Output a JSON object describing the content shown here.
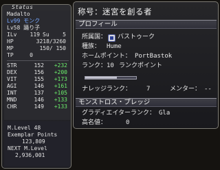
{
  "status": {
    "title": "Status",
    "name": "Madalto",
    "job_main": "Lv99 モンク",
    "job_sub": "Lv58 踊り子",
    "ilv_label": "ILv",
    "ilv_value": "119",
    "su_label": "Su",
    "su_value": "5",
    "hp_label": "HP",
    "hp_value": "3218/3260",
    "mp_label": "MP",
    "mp_value": "150/ 150",
    "tp_label": "TP",
    "tp_value": "0",
    "stats": [
      {
        "label": "STR",
        "base": "152",
        "bonus": "+232"
      },
      {
        "label": "DEX",
        "base": "156",
        "bonus": "+200"
      },
      {
        "label": "VIT",
        "base": "155",
        "bonus": "+173"
      },
      {
        "label": "AGI",
        "base": "146",
        "bonus": "+161"
      },
      {
        "label": "INT",
        "base": "137",
        "bonus": "+105"
      },
      {
        "label": "MND",
        "base": "146",
        "bonus": "+133"
      },
      {
        "label": "CHR",
        "base": "149",
        "bonus": "+133"
      }
    ],
    "master_level": "M.Level 48",
    "exemplar_label": "Exemplar Points",
    "exemplar_value": "123,809",
    "next_label": "NEXT M.Level",
    "next_value": "2,936,001"
  },
  "profile": {
    "title": "称号：迷宮を創る者",
    "section_profile": "プロフィール",
    "nation_label": "所属国：",
    "nation_value": "バストゥーク",
    "race_label": "種族：",
    "race_value": "Hume",
    "home_label": "ホームポイント：",
    "home_value": "PortBastok",
    "rank_label": "ランク：",
    "rank_value": "10",
    "rank_points_label": "ランクポイント",
    "rank_fill": 0.62,
    "knowledge_label": "ナレッジランク：",
    "knowledge_value": "7",
    "mentor_label": "メンター：",
    "mentor_value": "--",
    "section_pledge": "モンストロス・プレッジ",
    "gladiator_label": "グラディエイターランク：",
    "gladiator_value": "Gla",
    "highname_label": "高名値：",
    "highname_value": "0"
  },
  "colors": {
    "job_text": "#78a8ff",
    "bonus_text": "#6cf06c",
    "window_border": "#7d7b74"
  }
}
